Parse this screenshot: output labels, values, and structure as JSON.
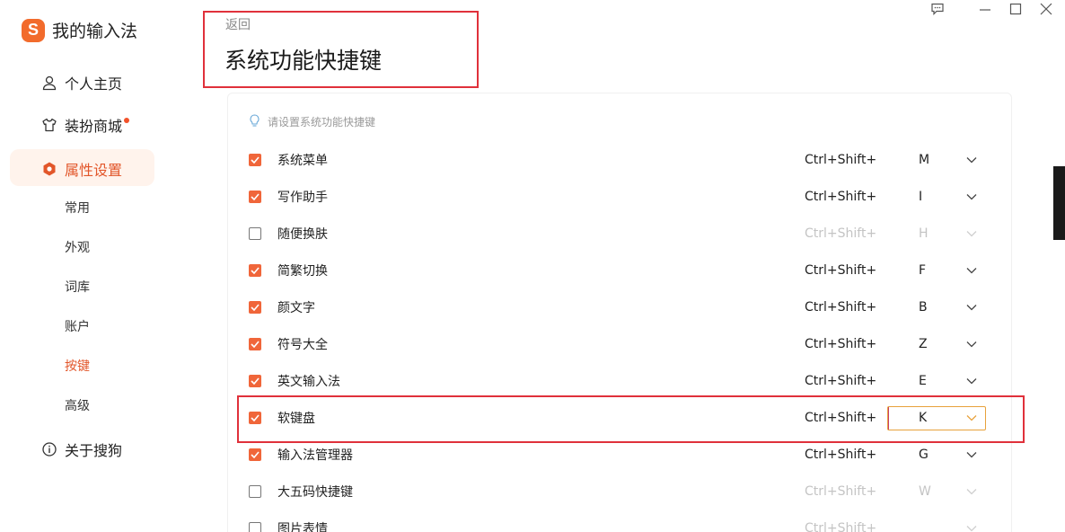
{
  "app": {
    "name": "我的输入法",
    "logo_glyph": "S"
  },
  "sidebar": {
    "items": [
      {
        "label": "个人主页",
        "icon": "person-icon"
      },
      {
        "label": "装扮商城",
        "icon": "shirt-icon",
        "badge_dot": true
      },
      {
        "label": "属性设置",
        "icon": "settings-hex-icon",
        "active": true
      },
      {
        "label": "关于搜狗",
        "icon": "info-icon"
      }
    ],
    "sub_items": [
      {
        "label": "常用"
      },
      {
        "label": "外观"
      },
      {
        "label": "词库"
      },
      {
        "label": "账户"
      },
      {
        "label": "按键",
        "active": true
      },
      {
        "label": "高级"
      }
    ]
  },
  "header": {
    "back_label": "返回",
    "title": "系统功能快捷键"
  },
  "panel": {
    "hint": "请设置系统功能快捷键",
    "rows": [
      {
        "label": "系统菜单",
        "checked": true,
        "modifier": "Ctrl+Shift+",
        "key": "M"
      },
      {
        "label": "写作助手",
        "checked": true,
        "modifier": "Ctrl+Shift+",
        "key": "I"
      },
      {
        "label": "随便换肤",
        "checked": false,
        "modifier": "Ctrl+Shift+",
        "key": "H"
      },
      {
        "label": "简繁切换",
        "checked": true,
        "modifier": "Ctrl+Shift+",
        "key": "F"
      },
      {
        "label": "颜文字",
        "checked": true,
        "modifier": "Ctrl+Shift+",
        "key": "B"
      },
      {
        "label": "符号大全",
        "checked": true,
        "modifier": "Ctrl+Shift+",
        "key": "Z"
      },
      {
        "label": "英文输入法",
        "checked": true,
        "modifier": "Ctrl+Shift+",
        "key": "E"
      },
      {
        "label": "软键盘",
        "checked": true,
        "modifier": "Ctrl+Shift+",
        "key": "K",
        "focused": true
      },
      {
        "label": "输入法管理器",
        "checked": true,
        "modifier": "Ctrl+Shift+",
        "key": "G"
      },
      {
        "label": "大五码快捷键",
        "checked": false,
        "modifier": "Ctrl+Shift+",
        "key": "W"
      },
      {
        "label": "图片表情",
        "checked": false,
        "modifier": "Ctrl+Shift+",
        "key": ""
      }
    ]
  },
  "colors": {
    "accent": "#f0663a",
    "highlight_box": "#e0313b",
    "disabled_text": "#c4c4c4"
  }
}
